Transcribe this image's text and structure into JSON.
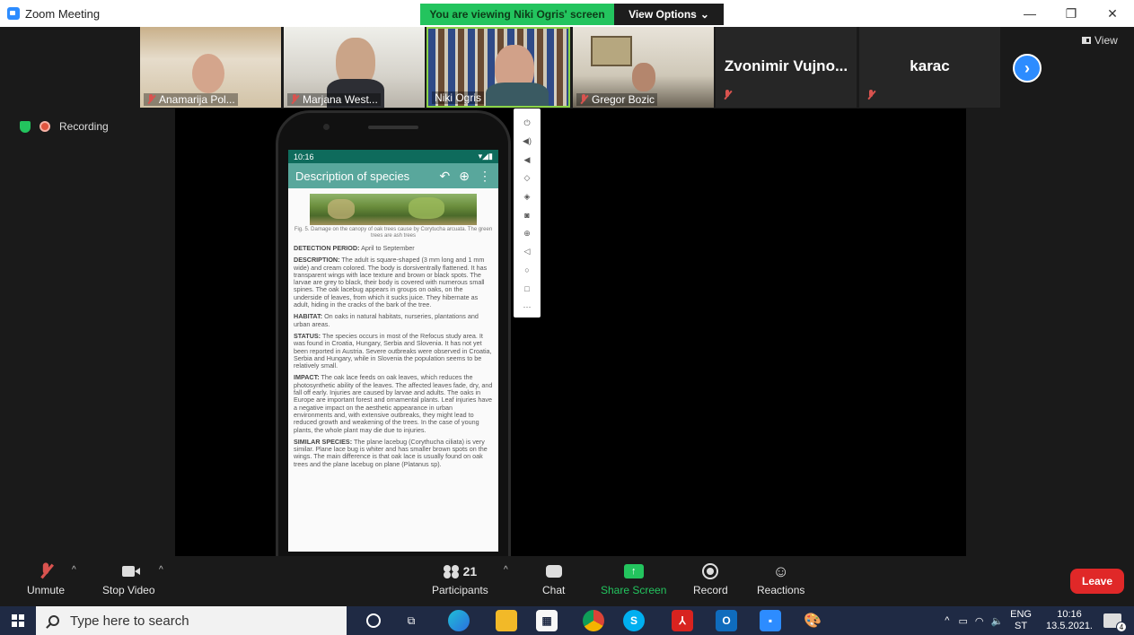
{
  "window": {
    "title": "Zoom Meeting",
    "viewing_banner": "You are viewing Niki Ogris' screen",
    "view_options": "View Options",
    "minimize": "—",
    "restore": "❐",
    "close": "✕"
  },
  "view_button": "View",
  "participants_strip": [
    {
      "name": "Anamarija Pol...",
      "muted": true,
      "video": true
    },
    {
      "name": "Marjana West...",
      "muted": true,
      "video": true
    },
    {
      "name": "Niki Ogris",
      "muted": false,
      "video": true,
      "active": true
    },
    {
      "name": "Gregor Bozic",
      "muted": true,
      "video": true
    },
    {
      "name": "Zvonimir Vujno...",
      "muted": true,
      "video": false
    },
    {
      "name": "karac",
      "muted": true,
      "video": false
    }
  ],
  "recording_label": "Recording",
  "phone": {
    "status_time": "10:16",
    "app_title": "Description of species",
    "figure_caption": "Fig. 5. Damage on the canopy of oak trees cause by Corytucha arcuata. The green trees are ash trees",
    "sections": [
      {
        "label": "DETECTION PERIOD:",
        "text": " April to September"
      },
      {
        "label": "DESCRIPTION:",
        "text": " The adult is square-shaped (3 mm long and 1 mm wide) and cream colored. The body is dorsiventrally flattened. It has transparent wings with lace texture and brown or black spots. The larvae are grey to black, their body is covered with numerous small spines. The oak lacebug appears in groups on oaks, on the underside of leaves, from which it sucks juice. They hibernate as adult, hiding in the cracks of the bark of the tree."
      },
      {
        "label": "HABITAT:",
        "text": " On oaks in natural habitats, nurseries, plantations and urban areas."
      },
      {
        "label": "STATUS:",
        "text": " The species occurs in most of the Refocus study area. It was found in Croatia, Hungary, Serbia and Slovenia. It has not yet been reported in Austria. Severe outbreaks were observed in Croatia, Serbia and Hungary, while in Slovenia the population seems to be relatively small."
      },
      {
        "label": "IMPACT:",
        "text": " The oak lace feeds on oak leaves, which reduces the photosynthetic ability of the leaves. The affected leaves fade, dry, and fall off early. Injuries are caused by larvae and adults. The oaks in Europe are important forest and ornamental plants. Leaf injuries have a negative impact on the aesthetic appearance in urban environments and, with extensive outbreaks, they might lead to reduced growth and weakening of the trees. In the case of young plants, the whole plant may die due to injuries."
      },
      {
        "label": "SIMILAR SPECIES:",
        "text": " The plane lacebug (Corythucha ciliata) is very similar. Plane lace bug is whiter and has smaller brown spots on the wings. The main difference is that oak lace is usually found on oak trees and the plane lacebug on plane (Platanus sp)."
      }
    ]
  },
  "emulator_tools": [
    "power-icon",
    "volume-up-icon",
    "volume-down-icon",
    "rotate-left-icon",
    "rotate-right-icon",
    "camera-icon",
    "zoom-icon",
    "back-icon",
    "home-icon",
    "overview-icon",
    "more-icon"
  ],
  "toolbar": {
    "unmute": "Unmute",
    "stop_video": "Stop Video",
    "participants": "Participants",
    "participants_count": "21",
    "chat": "Chat",
    "share_screen": "Share Screen",
    "record": "Record",
    "reactions": "Reactions",
    "leave": "Leave"
  },
  "taskbar": {
    "search_placeholder": "Type here to search",
    "lang_top": "ENG",
    "lang_bottom": "ST",
    "time": "10:16",
    "date": "13.5.2021.",
    "notifications": "4"
  },
  "colors": {
    "zoom_blue": "#2d8cff",
    "green": "#23c45e",
    "leave_red": "#e02828",
    "app_bar": "#59a79c"
  }
}
